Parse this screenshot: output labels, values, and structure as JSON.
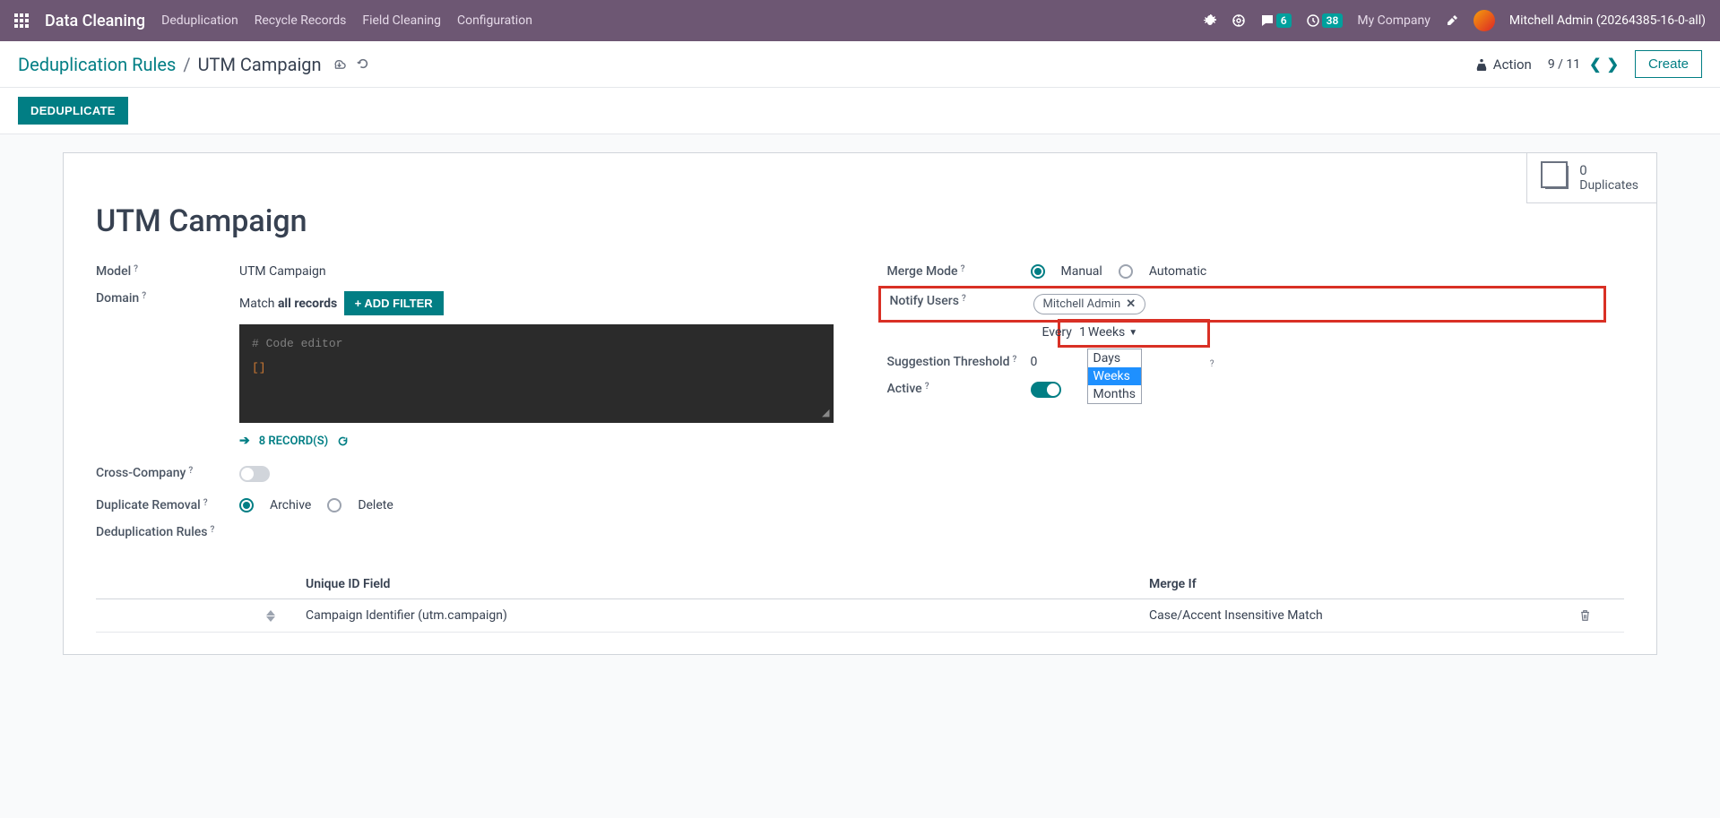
{
  "navbar": {
    "brand": "Data Cleaning",
    "links": [
      "Deduplication",
      "Recycle Records",
      "Field Cleaning",
      "Configuration"
    ],
    "messages_badge": "6",
    "activities_badge": "38",
    "company": "My Company",
    "user": "Mitchell Admin (20264385-16-0-all)"
  },
  "breadcrumb": {
    "parent": "Deduplication Rules",
    "current": "UTM Campaign",
    "action_label": "Action",
    "pager": "9 / 11",
    "create_label": "Create"
  },
  "status": {
    "deduplicate_label": "DEDUPLICATE"
  },
  "stat": {
    "count": "0",
    "label": "Duplicates"
  },
  "form": {
    "title": "UTM Campaign",
    "model_label": "Model",
    "model_value": "UTM Campaign",
    "domain_label": "Domain",
    "domain_match_prefix": "Match ",
    "domain_match_bold": "all records",
    "add_filter_label": "+ ADD FILTER",
    "code_comment": "# Code editor",
    "code_body": "[]",
    "records_count": "8 RECORD(S)",
    "cross_company_label": "Cross-Company",
    "cross_company_on": false,
    "dup_removal_label": "Duplicate Removal",
    "dup_removal_archive": "Archive",
    "dup_removal_delete": "Delete",
    "merge_mode_label": "Merge Mode",
    "merge_mode_manual": "Manual",
    "merge_mode_automatic": "Automatic",
    "notify_users_label": "Notify Users",
    "notify_user_tag": "Mitchell Admin",
    "every_label": "Every",
    "frequency_value": "1",
    "frequency_unit": "Weeks",
    "frequency_options": [
      "Days",
      "Weeks",
      "Months"
    ],
    "suggestion_label": "Suggestion Threshold",
    "suggestion_value": "0",
    "active_label": "Active",
    "active_on": true,
    "dedup_rules_label": "Deduplication Rules",
    "table": {
      "col_field": "Unique ID Field",
      "col_merge": "Merge If",
      "rows": [
        {
          "field": "Campaign Identifier (utm.campaign)",
          "merge": "Case/Accent Insensitive Match"
        }
      ]
    }
  }
}
